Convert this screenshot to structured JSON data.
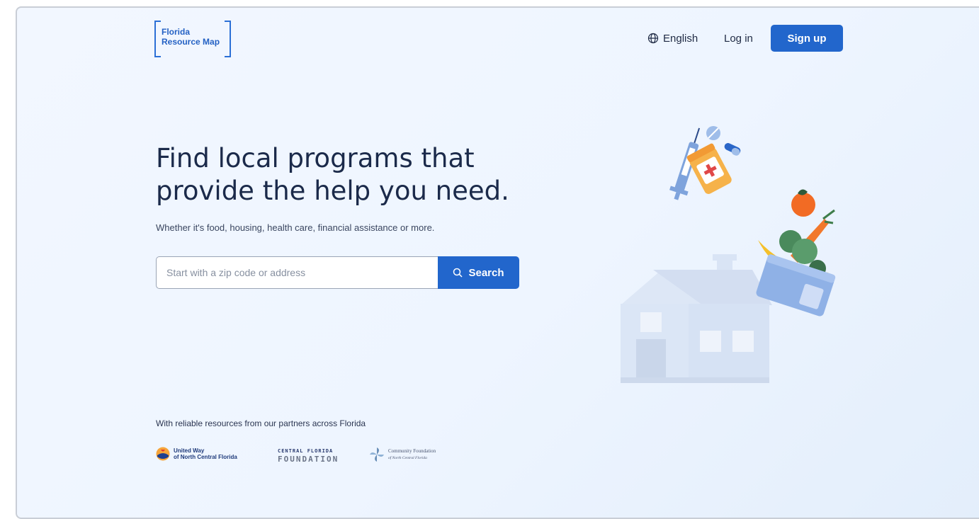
{
  "header": {
    "logo_line1": "Florida",
    "logo_line2": "Resource Map",
    "language_label": "English",
    "login_label": "Log in",
    "signup_label": "Sign up"
  },
  "hero": {
    "headline": "Find local programs that provide the help you need.",
    "subheadline": "Whether it's food, housing, health care, financial assistance or more.",
    "search": {
      "placeholder": "Start with a zip code or address",
      "value": "",
      "button_label": "Search"
    }
  },
  "partners": {
    "label": "With reliable resources from our partners across Florida",
    "united_way_line1": "United Way",
    "united_way_line2": "of North Central Florida",
    "cff_line1": "CENTRAL FLORIDA",
    "cff_line2": "FOUNDATION",
    "cf_line1": "Community Foundation",
    "cf_line2": "of North Central Florida"
  },
  "colors": {
    "primary": "#2266cc",
    "headline": "#1b2a4a",
    "background": "#eef5ff"
  },
  "icons": {
    "language": "globe-icon",
    "search": "search-icon"
  }
}
